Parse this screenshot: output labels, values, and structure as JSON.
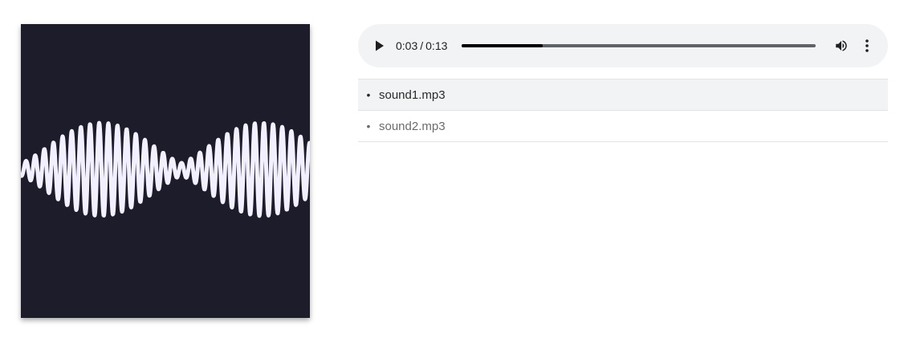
{
  "cover": {
    "background_color": "#1d1c2a",
    "wave_color": "#f2f0ff"
  },
  "player": {
    "current_time": "0:03",
    "separator": "/",
    "duration": "0:13",
    "progress": 0.23,
    "play_icon": "play-icon",
    "volume_icon": "volume-icon",
    "more_icon": "more-vertical-icon"
  },
  "playlist": {
    "bullet": "•",
    "items": [
      {
        "label": "sound1.mp3",
        "active": true
      },
      {
        "label": "sound2.mp3",
        "active": false
      }
    ]
  }
}
